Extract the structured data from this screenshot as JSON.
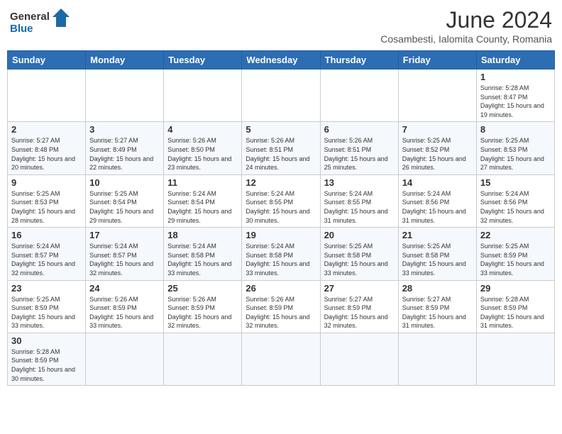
{
  "header": {
    "logo_text_regular": "General",
    "logo_text_accent": "Blue",
    "title": "June 2024",
    "subtitle": "Cosambesti, Ialomita County, Romania"
  },
  "days_of_week": [
    "Sunday",
    "Monday",
    "Tuesday",
    "Wednesday",
    "Thursday",
    "Friday",
    "Saturday"
  ],
  "weeks": [
    [
      {
        "date": "",
        "info": ""
      },
      {
        "date": "",
        "info": ""
      },
      {
        "date": "",
        "info": ""
      },
      {
        "date": "",
        "info": ""
      },
      {
        "date": "",
        "info": ""
      },
      {
        "date": "",
        "info": ""
      },
      {
        "date": "1",
        "info": "Sunrise: 5:28 AM\nSunset: 8:47 PM\nDaylight: 15 hours and 19 minutes."
      }
    ],
    [
      {
        "date": "2",
        "info": "Sunrise: 5:27 AM\nSunset: 8:48 PM\nDaylight: 15 hours and 20 minutes."
      },
      {
        "date": "3",
        "info": "Sunrise: 5:27 AM\nSunset: 8:49 PM\nDaylight: 15 hours and 22 minutes."
      },
      {
        "date": "4",
        "info": "Sunrise: 5:26 AM\nSunset: 8:50 PM\nDaylight: 15 hours and 23 minutes."
      },
      {
        "date": "5",
        "info": "Sunrise: 5:26 AM\nSunset: 8:51 PM\nDaylight: 15 hours and 24 minutes."
      },
      {
        "date": "6",
        "info": "Sunrise: 5:26 AM\nSunset: 8:51 PM\nDaylight: 15 hours and 25 minutes."
      },
      {
        "date": "7",
        "info": "Sunrise: 5:25 AM\nSunset: 8:52 PM\nDaylight: 15 hours and 26 minutes."
      },
      {
        "date": "8",
        "info": "Sunrise: 5:25 AM\nSunset: 8:53 PM\nDaylight: 15 hours and 27 minutes."
      }
    ],
    [
      {
        "date": "9",
        "info": "Sunrise: 5:25 AM\nSunset: 8:53 PM\nDaylight: 15 hours and 28 minutes."
      },
      {
        "date": "10",
        "info": "Sunrise: 5:25 AM\nSunset: 8:54 PM\nDaylight: 15 hours and 29 minutes."
      },
      {
        "date": "11",
        "info": "Sunrise: 5:24 AM\nSunset: 8:54 PM\nDaylight: 15 hours and 29 minutes."
      },
      {
        "date": "12",
        "info": "Sunrise: 5:24 AM\nSunset: 8:55 PM\nDaylight: 15 hours and 30 minutes."
      },
      {
        "date": "13",
        "info": "Sunrise: 5:24 AM\nSunset: 8:55 PM\nDaylight: 15 hours and 31 minutes."
      },
      {
        "date": "14",
        "info": "Sunrise: 5:24 AM\nSunset: 8:56 PM\nDaylight: 15 hours and 31 minutes."
      },
      {
        "date": "15",
        "info": "Sunrise: 5:24 AM\nSunset: 8:56 PM\nDaylight: 15 hours and 32 minutes."
      }
    ],
    [
      {
        "date": "16",
        "info": "Sunrise: 5:24 AM\nSunset: 8:57 PM\nDaylight: 15 hours and 32 minutes."
      },
      {
        "date": "17",
        "info": "Sunrise: 5:24 AM\nSunset: 8:57 PM\nDaylight: 15 hours and 32 minutes."
      },
      {
        "date": "18",
        "info": "Sunrise: 5:24 AM\nSunset: 8:58 PM\nDaylight: 15 hours and 33 minutes."
      },
      {
        "date": "19",
        "info": "Sunrise: 5:24 AM\nSunset: 8:58 PM\nDaylight: 15 hours and 33 minutes."
      },
      {
        "date": "20",
        "info": "Sunrise: 5:25 AM\nSunset: 8:58 PM\nDaylight: 15 hours and 33 minutes."
      },
      {
        "date": "21",
        "info": "Sunrise: 5:25 AM\nSunset: 8:58 PM\nDaylight: 15 hours and 33 minutes."
      },
      {
        "date": "22",
        "info": "Sunrise: 5:25 AM\nSunset: 8:59 PM\nDaylight: 15 hours and 33 minutes."
      }
    ],
    [
      {
        "date": "23",
        "info": "Sunrise: 5:25 AM\nSunset: 8:59 PM\nDaylight: 15 hours and 33 minutes."
      },
      {
        "date": "24",
        "info": "Sunrise: 5:26 AM\nSunset: 8:59 PM\nDaylight: 15 hours and 33 minutes."
      },
      {
        "date": "25",
        "info": "Sunrise: 5:26 AM\nSunset: 8:59 PM\nDaylight: 15 hours and 32 minutes."
      },
      {
        "date": "26",
        "info": "Sunrise: 5:26 AM\nSunset: 8:59 PM\nDaylight: 15 hours and 32 minutes."
      },
      {
        "date": "27",
        "info": "Sunrise: 5:27 AM\nSunset: 8:59 PM\nDaylight: 15 hours and 32 minutes."
      },
      {
        "date": "28",
        "info": "Sunrise: 5:27 AM\nSunset: 8:59 PM\nDaylight: 15 hours and 31 minutes."
      },
      {
        "date": "29",
        "info": "Sunrise: 5:28 AM\nSunset: 8:59 PM\nDaylight: 15 hours and 31 minutes."
      }
    ],
    [
      {
        "date": "30",
        "info": "Sunrise: 5:28 AM\nSunset: 8:59 PM\nDaylight: 15 hours and 30 minutes."
      },
      {
        "date": "",
        "info": ""
      },
      {
        "date": "",
        "info": ""
      },
      {
        "date": "",
        "info": ""
      },
      {
        "date": "",
        "info": ""
      },
      {
        "date": "",
        "info": ""
      },
      {
        "date": "",
        "info": ""
      }
    ]
  ]
}
